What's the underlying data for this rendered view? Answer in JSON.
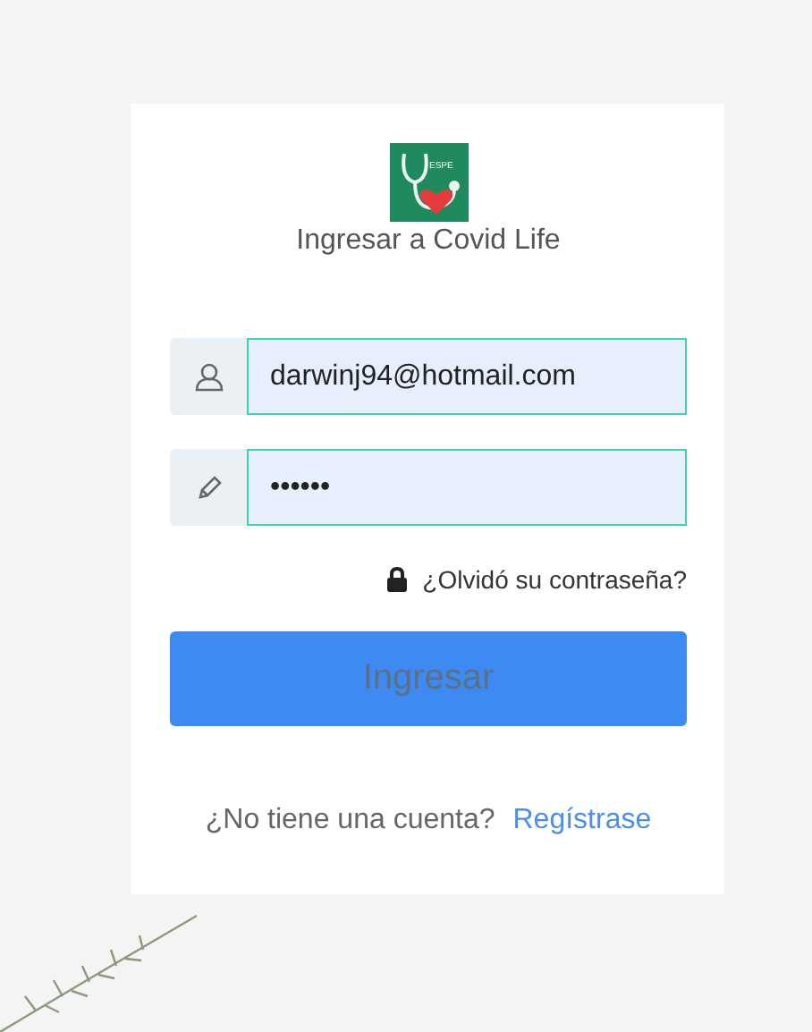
{
  "logo": {
    "text": "ESPE"
  },
  "title": "Ingresar a Covid Life",
  "fields": [
    {
      "kind": "email",
      "value": "darwinj94@hotmail.com"
    },
    {
      "kind": "password",
      "value": "••••••"
    }
  ],
  "forgot_link": "¿Olvidó su contraseña?",
  "submit_button": "Ingresar",
  "signup": {
    "prompt": "¿No tiene una cuenta?",
    "link": "Regístrase"
  }
}
